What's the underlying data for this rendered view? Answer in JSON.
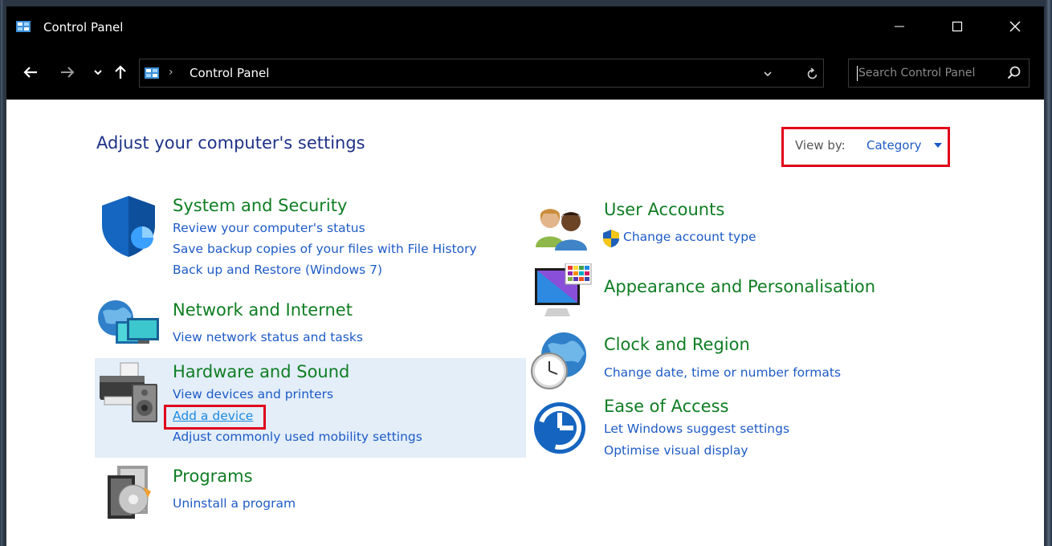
{
  "window": {
    "title": "Control Panel"
  },
  "address": {
    "crumb": "Control Panel",
    "separator": "›"
  },
  "search": {
    "placeholder": "Search Control Panel"
  },
  "heading": "Adjust your computer's settings",
  "view_by": {
    "label": "View by:",
    "value": "Category"
  },
  "categories": {
    "system_security": {
      "title": "System and Security",
      "links": [
        "Review your computer's status",
        "Save backup copies of your files with File History",
        "Back up and Restore (Windows 7)"
      ]
    },
    "network": {
      "title": "Network and Internet",
      "links": [
        "View network status and tasks"
      ]
    },
    "hardware": {
      "title": "Hardware and Sound",
      "links": [
        "View devices and printers",
        "Add a device",
        "Adjust commonly used mobility settings"
      ]
    },
    "programs": {
      "title": "Programs",
      "links": [
        "Uninstall a program"
      ]
    },
    "user_accounts": {
      "title": "User Accounts",
      "links": [
        "Change account type"
      ]
    },
    "appearance": {
      "title": "Appearance and Personalisation"
    },
    "clock": {
      "title": "Clock and Region",
      "links": [
        "Change date, time or number formats"
      ]
    },
    "ease": {
      "title": "Ease of Access",
      "links": [
        "Let Windows suggest settings",
        "Optimise visual display"
      ]
    }
  },
  "colors": {
    "title_bar": "#000000",
    "category_title": "#0f7d23",
    "link": "#1e5bc6",
    "heading": "#1e3287",
    "highlight_box": "#e0001b",
    "hover_background": "#e3eef9"
  }
}
